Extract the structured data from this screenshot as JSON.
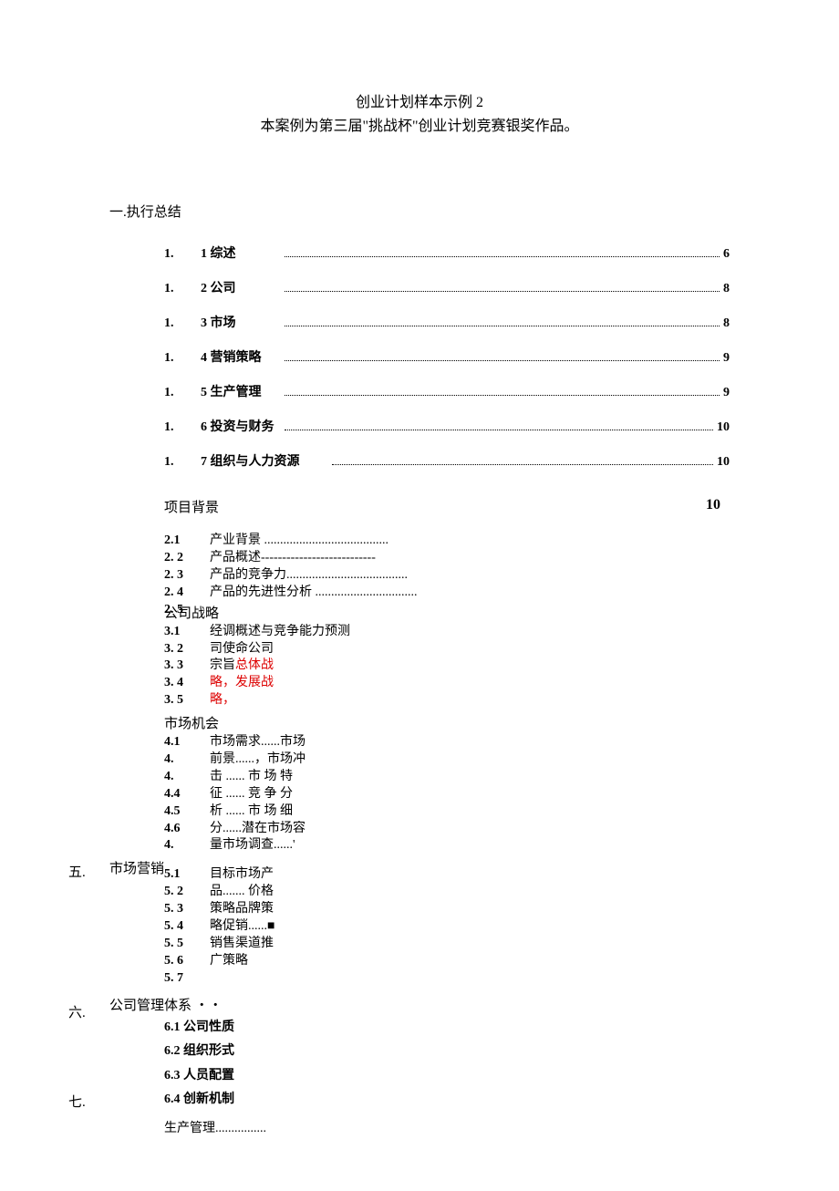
{
  "title": {
    "line1": "创业计划样本示例 2",
    "line2": "本案例为第三届\"挑战杯\"创业计划竞赛银奖作品。"
  },
  "section1": {
    "heading": "一.执行总结",
    "items": [
      {
        "num": "1.",
        "sub": "1 综述",
        "page": "6"
      },
      {
        "num": "1.",
        "sub": "2 公司",
        "page": "8"
      },
      {
        "num": "1.",
        "sub": "3 市场",
        "page": "8"
      },
      {
        "num": "1.",
        "sub": "4 营销策略",
        "page": "9"
      },
      {
        "num": "1.",
        "sub": "5 生产管理",
        "page": "9"
      },
      {
        "num": "1.",
        "sub": "6 投资与财务",
        "page": "10"
      },
      {
        "num": "1.",
        "sub": "7 组织与人力资源",
        "page": "10"
      }
    ]
  },
  "section2": {
    "heading": "项目背景",
    "page": "10",
    "items": [
      {
        "num": "2.1",
        "text": "产业背景 ......................................."
      },
      {
        "num": "2.  2",
        "text": "产品概述---------------------------"
      },
      {
        "num": "2.  3",
        "text": "产品的竞争力......................................"
      },
      {
        "num": "2.  4",
        "text": "产品的先进性分析 ................................"
      },
      {
        "num": "2.  5",
        "text": ""
      }
    ]
  },
  "section3": {
    "heading": "公司战略",
    "overlay": "经调概述与竞争能力预测",
    "items": [
      {
        "num": "3.1",
        "text": "司使命公司"
      },
      {
        "num": "3.  2",
        "text": "宗旨总体战",
        "redPart": "总体战",
        "blackPart": "宗旨"
      },
      {
        "num": "3.  3",
        "text": "略，发展战",
        "redAll": true
      },
      {
        "num": "3.  4",
        "text": "略，",
        "redAll": true
      },
      {
        "num": "3.  5",
        "text": ""
      }
    ]
  },
  "section4": {
    "heading": "市场机会",
    "items": [
      {
        "num": "4.1",
        "text": "市场需求......市场"
      },
      {
        "num": "4.",
        "text": "前景......，市场冲"
      },
      {
        "num": "4.",
        "text": "击 ...... 市 场 特"
      },
      {
        "num": "4.4",
        "text": "征 ...... 竞 争 分"
      },
      {
        "num": "4.5",
        "text": "析 ...... 市 场 细"
      },
      {
        "num": "4.6",
        "text": "分......潜在市场容"
      },
      {
        "num": "4.",
        "text": "量市场调查......'"
      }
    ]
  },
  "section5": {
    "label": "五.",
    "heading": "市场营销",
    "items": [
      {
        "num": "5.1",
        "text": "目标市场产"
      },
      {
        "num": "5.  2",
        "text": "品....... 价格"
      },
      {
        "num": "5.  3",
        "text": "策略品牌策"
      },
      {
        "num": "5.  4",
        "text": "略促销......■"
      },
      {
        "num": "5.  5",
        "text": "销售渠道推"
      },
      {
        "num": "5.  6",
        "text": "广策略"
      },
      {
        "num": "5.  7",
        "text": ""
      }
    ]
  },
  "section6": {
    "label": "六.",
    "heading": "公司管理体系 ・・",
    "items": [
      "6.1 公司性质",
      "6.2 组织形式",
      "6.3 人员配置",
      "6.4 创新机制"
    ]
  },
  "section7": {
    "label": "七.",
    "heading": "生产管理................"
  }
}
